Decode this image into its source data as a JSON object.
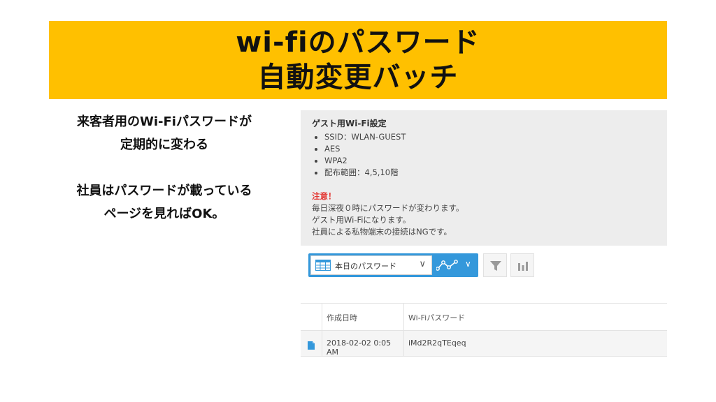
{
  "banner": {
    "line1": "wi-fiのパスワード",
    "line2": "自動変更バッチ"
  },
  "description": {
    "line1": "来客者用のWi-Fiパスワードが",
    "line2": "定期的に変わる",
    "line3": "社員はパスワードが載っている",
    "line4": "ページを見ればOK。"
  },
  "info": {
    "title": "ゲスト用Wi-Fi設定",
    "items": [
      "SSID：WLAN-GUEST",
      "AES",
      "WPA2",
      "配布範囲：4,5,10階"
    ],
    "warning_label": "注意！",
    "notes": [
      "毎日深夜０時にパスワードが変わります。",
      "ゲスト用Wi-Fiになります。",
      "社員による私物端末の接続はNGです。"
    ]
  },
  "toolbar": {
    "view_label": "本日のパスワード",
    "view_chevron": "∨",
    "graph_chevron": "∨"
  },
  "table": {
    "columns": [
      "作成日時",
      "Wi-Fiパスワード"
    ],
    "rows": [
      {
        "created": "2018-02-02 0:05 AM",
        "password": "iMd2R2qTEqeq"
      }
    ]
  },
  "colors": {
    "banner": "#ffc000",
    "accent": "#3498db",
    "warning": "#e3342f"
  }
}
